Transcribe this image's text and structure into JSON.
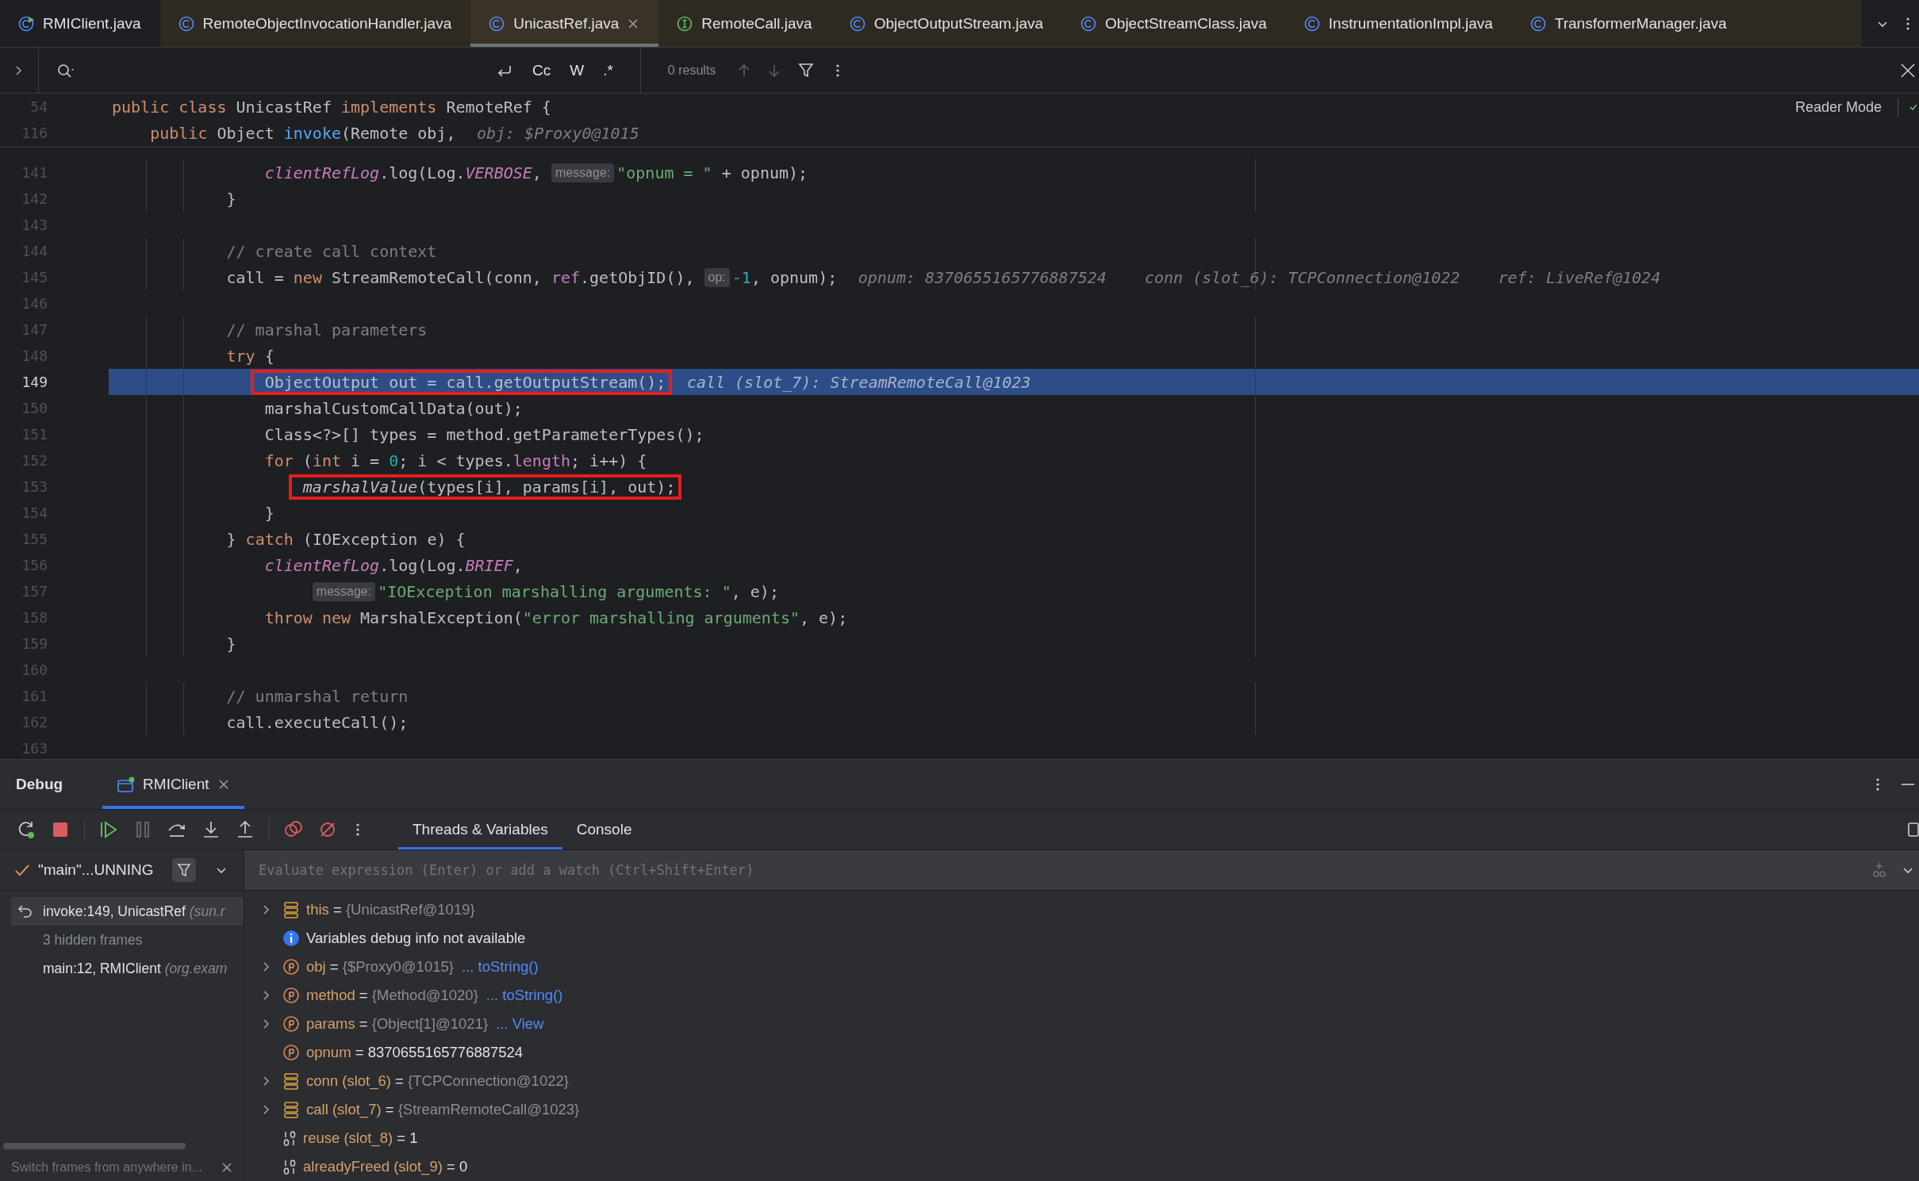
{
  "editor_tabs": [
    {
      "label": "RMIClient.java",
      "kind": "main-class",
      "library": false,
      "selected": false
    },
    {
      "label": "RemoteObjectInvocationHandler.java",
      "kind": "class",
      "library": true,
      "selected": false
    },
    {
      "label": "UnicastRef.java",
      "kind": "class",
      "library": true,
      "selected": true
    },
    {
      "label": "RemoteCall.java",
      "kind": "interface",
      "library": true,
      "selected": false
    },
    {
      "label": "ObjectOutputStream.java",
      "kind": "class",
      "library": true,
      "selected": false
    },
    {
      "label": "ObjectStreamClass.java",
      "kind": "class",
      "library": true,
      "selected": false
    },
    {
      "label": "InstrumentationImpl.java",
      "kind": "class",
      "library": true,
      "selected": false
    },
    {
      "label": "TransformerManager.java",
      "kind": "class",
      "library": true,
      "selected": false
    }
  ],
  "find_bar": {
    "options": [
      {
        "label": "Cc",
        "selected": false
      },
      {
        "label": "W",
        "selected": false
      },
      {
        "label": ".*",
        "selected": false
      }
    ],
    "results": "0 results"
  },
  "editor": {
    "reader_mode": "Reader Mode",
    "sticky_lines": [
      {
        "number": "54",
        "segments": [
          {
            "text": "public class",
            "kind": "keyword"
          },
          {
            "text": " UnicastRef ",
            "kind": "plain"
          },
          {
            "text": "implements",
            "kind": "keyword"
          },
          {
            "text": " RemoteRef {",
            "kind": "plain"
          }
        ]
      },
      {
        "number": "116",
        "segments": [
          {
            "text": "    public",
            "kind": "keyword"
          },
          {
            "text": " Object ",
            "kind": "plain"
          },
          {
            "text": "invoke",
            "kind": "method"
          },
          {
            "text": "(Remote obj,",
            "kind": "plain"
          },
          {
            "text": "obj: $Proxy0@1015",
            "kind": "value"
          }
        ]
      }
    ],
    "lines": [
      {
        "number": "141",
        "current": false,
        "boxed": false,
        "segments": [
          {
            "text": "                clientRefLog",
            "kind": "static"
          },
          {
            "text": ".log(Log.",
            "kind": "plain"
          },
          {
            "text": "VERBOSE",
            "kind": "static"
          },
          {
            "text": ",",
            "kind": "plain"
          },
          {
            "text": "message:",
            "kind": "hint"
          },
          {
            "text": "\"opnum = \"",
            "kind": "string"
          },
          {
            "text": " + opnum);",
            "kind": "plain"
          }
        ]
      },
      {
        "number": "142",
        "current": false,
        "boxed": false,
        "segments": [
          {
            "text": "            }",
            "kind": "plain"
          }
        ]
      },
      {
        "number": "143",
        "current": false,
        "boxed": false
      },
      {
        "number": "144",
        "current": false,
        "boxed": false,
        "segments": [
          {
            "text": "            // create call context",
            "kind": "comment"
          }
        ]
      },
      {
        "number": "145",
        "current": false,
        "boxed": false,
        "segments": [
          {
            "text": "            call = ",
            "kind": "plain"
          },
          {
            "text": "new",
            "kind": "keyword"
          },
          {
            "text": " StreamRemoteCall(conn, ",
            "kind": "plain"
          },
          {
            "text": "ref",
            "kind": "field"
          },
          {
            "text": ".getObjID(),",
            "kind": "plain"
          },
          {
            "text": "op:",
            "kind": "hint"
          },
          {
            "text": "-1",
            "kind": "number"
          },
          {
            "text": ", opnum);",
            "kind": "plain"
          },
          {
            "text": "opnum: 8370655165776887524",
            "kind": "value"
          },
          {
            "text": "conn (slot_6): TCPConnection@1022",
            "kind": "value"
          },
          {
            "text": "ref: LiveRef@1024",
            "kind": "value"
          }
        ]
      },
      {
        "number": "146",
        "current": false,
        "boxed": false
      },
      {
        "number": "147",
        "current": false,
        "boxed": false,
        "segments": [
          {
            "text": "            // marshal parameters",
            "kind": "comment"
          }
        ]
      },
      {
        "number": "148",
        "current": false,
        "boxed": false,
        "segments": [
          {
            "text": "            try",
            "kind": "keyword"
          },
          {
            "text": " {",
            "kind": "plain"
          }
        ]
      },
      {
        "number": "149",
        "current": true,
        "boxed": true,
        "segments": [
          {
            "text": "                ObjectOutput out = call.getOutputStream();",
            "kind": "plain"
          },
          {
            "text": "call (slot_7): StreamRemoteCall@1023",
            "kind": "value"
          }
        ]
      },
      {
        "number": "150",
        "current": false,
        "boxed": false,
        "segments": [
          {
            "text": "                marshalCustomCallData(out);",
            "kind": "plain"
          }
        ]
      },
      {
        "number": "151",
        "current": false,
        "boxed": false,
        "segments": [
          {
            "text": "                Class<?>[] types = method.getParameterTypes();",
            "kind": "plain"
          }
        ]
      },
      {
        "number": "152",
        "current": false,
        "boxed": false,
        "segments": [
          {
            "text": "                for",
            "kind": "keyword"
          },
          {
            "text": " (",
            "kind": "plain"
          },
          {
            "text": "int",
            "kind": "keyword"
          },
          {
            "text": " i = ",
            "kind": "plain"
          },
          {
            "text": "0",
            "kind": "number"
          },
          {
            "text": "; i < types.",
            "kind": "plain"
          },
          {
            "text": "length",
            "kind": "field"
          },
          {
            "text": "; i++) {",
            "kind": "plain"
          }
        ]
      },
      {
        "number": "153",
        "current": false,
        "boxed": true,
        "segments": [
          {
            "text": "                    marshalValue",
            "kind": "static-call"
          },
          {
            "text": "(types[i], params[i], out);",
            "kind": "plain"
          }
        ]
      },
      {
        "number": "154",
        "current": false,
        "boxed": false,
        "segments": [
          {
            "text": "                }",
            "kind": "plain"
          }
        ]
      },
      {
        "number": "155",
        "current": false,
        "boxed": false,
        "segments": [
          {
            "text": "            } ",
            "kind": "plain"
          },
          {
            "text": "catch",
            "kind": "keyword"
          },
          {
            "text": " (IOException e) {",
            "kind": "plain"
          }
        ]
      },
      {
        "number": "156",
        "current": false,
        "boxed": false,
        "segments": [
          {
            "text": "                clientRefLog",
            "kind": "static"
          },
          {
            "text": ".log(Log.",
            "kind": "plain"
          },
          {
            "text": "BRIEF",
            "kind": "static"
          },
          {
            "text": ",",
            "kind": "plain"
          }
        ]
      },
      {
        "number": "157",
        "current": false,
        "boxed": false,
        "segments": [
          {
            "text": "                    message:",
            "kind": "hint"
          },
          {
            "text": "\"IOException marshalling arguments: \"",
            "kind": "string"
          },
          {
            "text": ", e);",
            "kind": "plain"
          }
        ]
      },
      {
        "number": "158",
        "current": false,
        "boxed": false,
        "segments": [
          {
            "text": "                throw new",
            "kind": "keyword"
          },
          {
            "text": " MarshalException(",
            "kind": "plain"
          },
          {
            "text": "\"error marshalling arguments\"",
            "kind": "string"
          },
          {
            "text": ", e);",
            "kind": "plain"
          }
        ]
      },
      {
        "number": "159",
        "current": false,
        "boxed": false,
        "segments": [
          {
            "text": "            }",
            "kind": "plain"
          }
        ]
      },
      {
        "number": "160",
        "current": false,
        "boxed": false
      },
      {
        "number": "161",
        "current": false,
        "boxed": false,
        "segments": [
          {
            "text": "            // unmarshal return",
            "kind": "comment"
          }
        ]
      },
      {
        "number": "162",
        "current": false,
        "boxed": false,
        "segments": [
          {
            "text": "            call.executeCall();",
            "kind": "plain"
          }
        ]
      },
      {
        "number": "163",
        "current": false,
        "boxed": false
      }
    ]
  },
  "debug": {
    "title": "Debug",
    "sessions": [
      {
        "label": "RMIClient",
        "selected": true
      }
    ],
    "tabs": [
      {
        "label": "Threads & Variables",
        "selected": true
      },
      {
        "label": "Console",
        "selected": false
      }
    ],
    "thread": "\"main\"...UNNING",
    "frames": [
      {
        "kind": "frame",
        "method": "invoke:149, UnicastRef ",
        "package": "(sun.r",
        "selected": true
      },
      {
        "kind": "hidden",
        "method": "3 hidden frames",
        "selected": false
      },
      {
        "kind": "frame",
        "method": "main:12, RMIClient ",
        "package": "(org.exam",
        "selected": false
      }
    ],
    "frames_hint": "Switch frames from anywhere in...",
    "evaluate": {
      "placeholder": "Evaluate expression (Enter) or add a watch (Ctrl+Shift+Enter)"
    },
    "variables": [
      {
        "kind": "object",
        "name": "this",
        "sign": "=",
        "value": "{UnicastRef@1019}",
        "expandable": true
      },
      {
        "kind": "info",
        "name": "Variables debug info not available",
        "expandable": false
      },
      {
        "kind": "param",
        "name": "obj",
        "sign": "=",
        "value": "{$Proxy0@1015}",
        "link": "... toString()",
        "expandable": true
      },
      {
        "kind": "param",
        "name": "method",
        "sign": "=",
        "value": "{Method@1020}",
        "link": "... toString()",
        "expandable": true
      },
      {
        "kind": "param",
        "name": "params",
        "sign": "=",
        "value": "{Object[1]@1021}",
        "link": "... View",
        "expandable": true
      },
      {
        "kind": "param",
        "name": "opnum",
        "sign": "=",
        "value": "8370655165776887524",
        "expandable": false
      },
      {
        "kind": "object",
        "name": "conn (slot_6)",
        "sign": "=",
        "value": "{TCPConnection@1022}",
        "expandable": true
      },
      {
        "kind": "object",
        "name": "call (slot_7)",
        "sign": "=",
        "value": "{StreamRemoteCall@1023}",
        "expandable": true
      },
      {
        "kind": "primitive",
        "name": "reuse (slot_8)",
        "sign": "=",
        "value": "1",
        "expandable": false
      },
      {
        "kind": "primitive",
        "name": "alreadyFreed (slot_9)",
        "sign": "=",
        "value": "0",
        "expandable": false
      }
    ]
  }
}
